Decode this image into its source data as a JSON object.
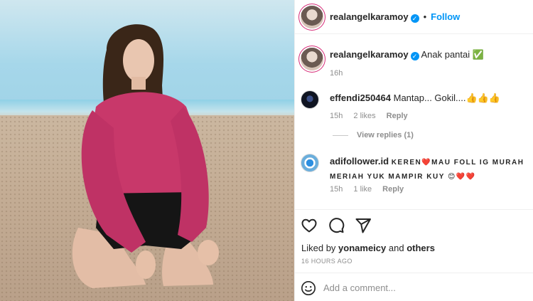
{
  "post": {
    "author": "realangelkaramoy",
    "follow_label": "Follow",
    "separator": "•"
  },
  "caption": {
    "author": "realangelkaramoy",
    "text": "Anak pantai ✅",
    "time": "16h"
  },
  "comments": [
    {
      "author": "effendi250464",
      "text": "Mantap... Gokil....👍👍👍",
      "time": "15h",
      "likes": "2 likes",
      "reply_label": "Reply"
    },
    {
      "author": "adifollower.id",
      "text": "KEREN❤️MAU FOLL IG MURAH MERIAH YUK MAMPIR KUY 😊❤️❤️",
      "time": "15h",
      "likes": "1 like",
      "reply_label": "Reply"
    }
  ],
  "view_replies": "View replies (1)",
  "likes": {
    "prefix": "Liked by",
    "user": "yonameicy",
    "and": "and",
    "others": "others"
  },
  "timestamp": "16 HOURS AGO",
  "add_comment": {
    "placeholder": "Add a comment..."
  },
  "colors": {
    "accent": "#0095f6",
    "top": "#c8386a",
    "shorts": "#151515"
  }
}
